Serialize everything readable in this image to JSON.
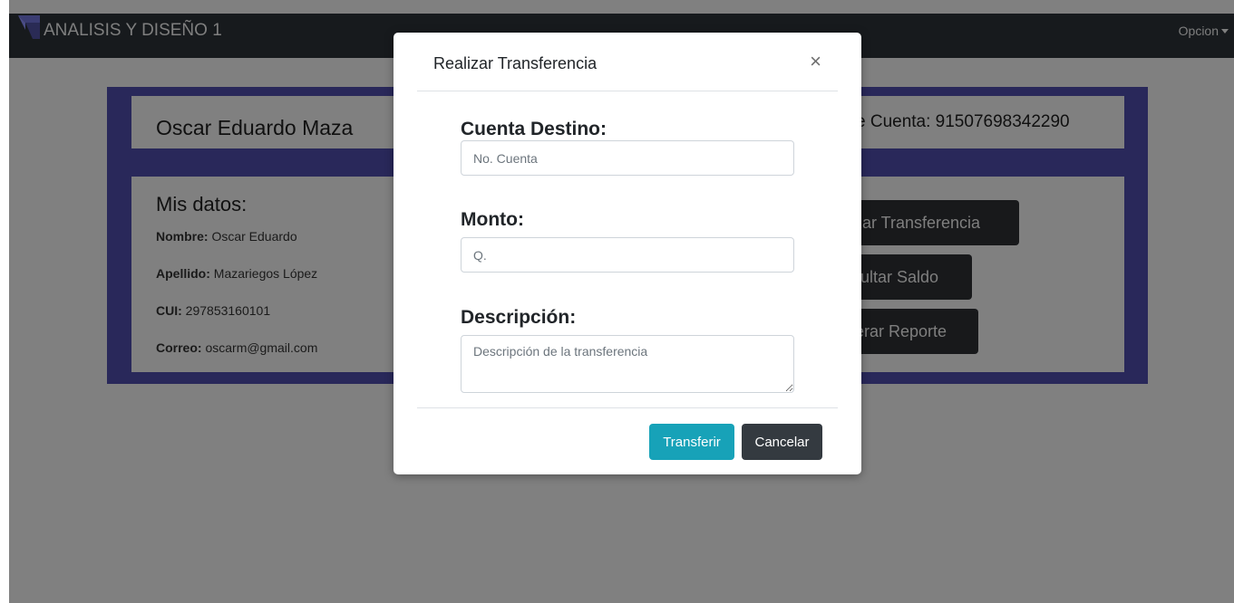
{
  "navbar": {
    "brand": "ANALISIS Y DISEÑO 1",
    "option": "Opcion"
  },
  "profile": {
    "name_visible": "Oscar Eduardo Maza",
    "account_visible": "e Cuenta: 91507698342290"
  },
  "mis_datos": {
    "title": "Mis datos:",
    "items": [
      {
        "label": "Nombre:",
        "value": "Oscar Eduardo"
      },
      {
        "label": "Apellido:",
        "value": "Mazariegos López"
      },
      {
        "label": "CUI:",
        "value": "297853160101"
      },
      {
        "label": "Correo:",
        "value": "oscarm@gmail.com"
      }
    ]
  },
  "actions": {
    "transfer_visible": "izar Transferencia",
    "balance_visible": "sultar Saldo",
    "report_visible": "erar Reporte"
  },
  "modal": {
    "title": "Realizar Transferencia",
    "close": "×",
    "cuenta_label": "Cuenta Destino:",
    "cuenta_placeholder": "No. Cuenta",
    "monto_label": "Monto:",
    "monto_placeholder": "Q.",
    "descripcion_label": "Descripción:",
    "descripcion_placeholder": "Descripción de la transferencia",
    "transferir": "Transferir",
    "cancelar": "Cancelar"
  },
  "colors": {
    "accent_info": "#17a2b8",
    "dark": "#343a40",
    "panel_border": "#5253a8"
  }
}
